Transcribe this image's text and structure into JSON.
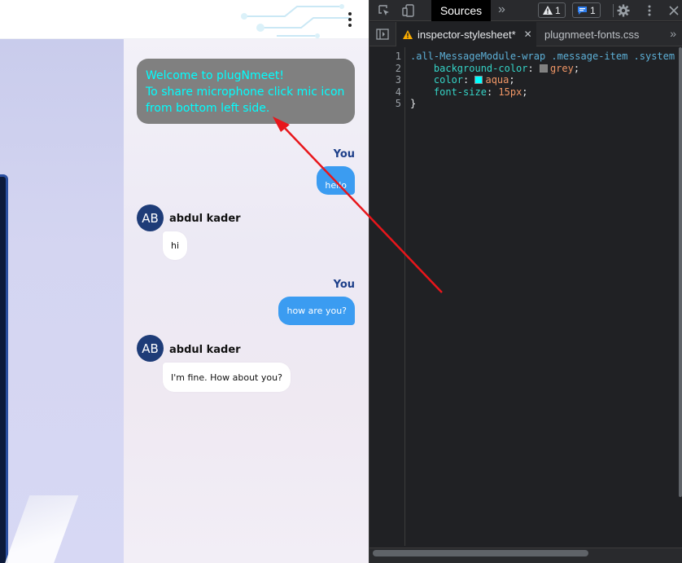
{
  "chat": {
    "system_message": "Welcome to plugNmeet!\nTo share microphone click mic icon\nfrom bottom left side.",
    "messages": [
      {
        "sender": "You",
        "text": "hello"
      },
      {
        "sender": "abdul kader",
        "initials": "AB",
        "text": "hi"
      },
      {
        "sender": "You",
        "text": "how are you?"
      },
      {
        "sender": "abdul kader",
        "initials": "AB",
        "text": "I'm fine. How about you?"
      }
    ]
  },
  "devtools": {
    "active_panel": "Sources",
    "warnings_count": "1",
    "messages_count": "1",
    "tabs": {
      "active": "inspector-stylesheet*",
      "other": "plugnmeet-fonts.css"
    },
    "code": {
      "line_numbers": [
        "1",
        "2",
        "3",
        "4",
        "5"
      ],
      "selector": ".all-MessageModule-wrap .message-item .system",
      "props": [
        {
          "name": "background-color",
          "value": "grey",
          "swatch": "#808080"
        },
        {
          "name": "color",
          "value": "aqua",
          "swatch": "#00ffff"
        },
        {
          "name": "font-size",
          "value": "15px"
        }
      ]
    }
  },
  "colors": {
    "system_bubble_bg": "#808080",
    "system_bubble_text": "#00ffff",
    "outgoing_bubble": "#3b9cf1",
    "avatar_bg": "#1e3c78",
    "annotation_arrow": "#e8161b"
  },
  "icons": [
    "kebab-menu-icon",
    "inspect-element-icon",
    "device-toolbar-icon",
    "warning-icon",
    "message-icon",
    "gear-icon",
    "more-vert-icon",
    "close-icon",
    "navigator-toggle-icon",
    "chevron-right-icon"
  ]
}
